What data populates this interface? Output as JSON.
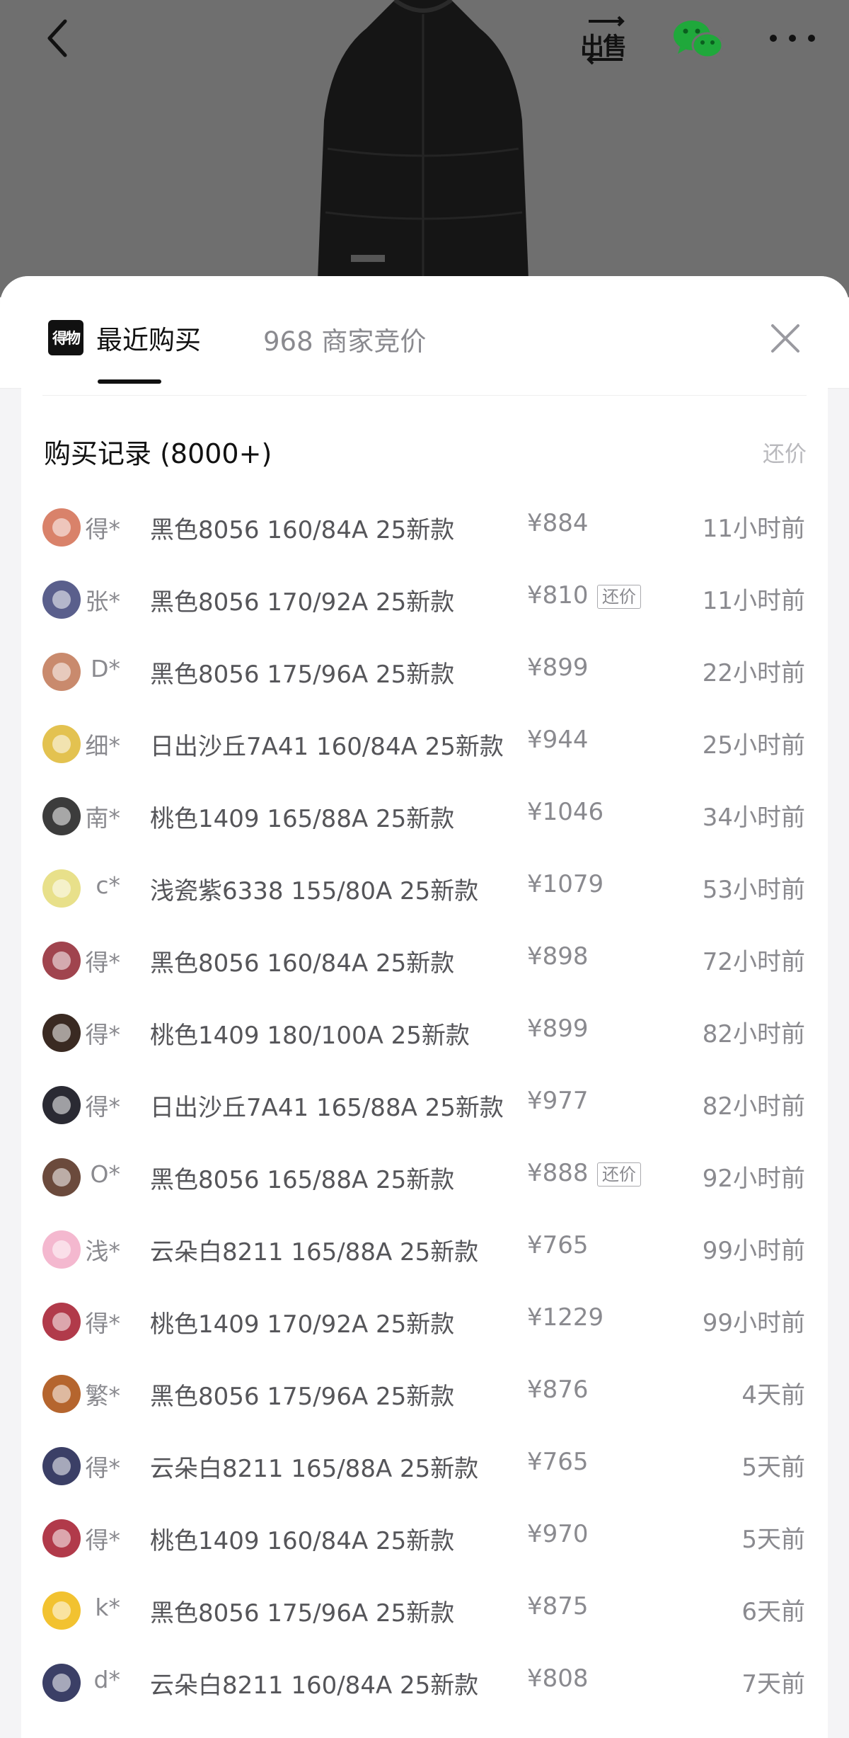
{
  "topbar": {
    "back_icon": "back-arrow-icon",
    "sell_label": "出售",
    "wechat_icon": "wechat-icon",
    "more_icon": "more-dots-icon"
  },
  "tabs": {
    "logo_text": "得物",
    "recent_label": "最近购买",
    "merchant_label": "968 商家竞价"
  },
  "records": {
    "title": "购买记录 (8000+)",
    "bargain_link": "还价",
    "badge_label": "还价",
    "rows": [
      {
        "user": "得*",
        "spec": "黑色8056 160/84A 25新款",
        "price": "¥884",
        "time": "11小时前",
        "bargain": false,
        "avatar_color": "#d9826a"
      },
      {
        "user": "张*",
        "spec": "黑色8056 170/92A 25新款",
        "price": "¥810",
        "time": "11小时前",
        "bargain": true,
        "avatar_color": "#5a5f8c"
      },
      {
        "user": "D*",
        "spec": "黑色8056 175/96A 25新款",
        "price": "¥899",
        "time": "22小时前",
        "bargain": false,
        "avatar_color": "#c98a6d"
      },
      {
        "user": "细*",
        "spec": "日出沙丘7A41 160/84A 25新款",
        "price": "¥944",
        "time": "25小时前",
        "bargain": false,
        "avatar_color": "#e3c250"
      },
      {
        "user": "南*",
        "spec": "桃色1409 165/88A 25新款",
        "price": "¥1046",
        "time": "34小时前",
        "bargain": false,
        "avatar_color": "#3c3c3c"
      },
      {
        "user": "c*",
        "spec": "浅瓷紫6338 155/80A 25新款",
        "price": "¥1079",
        "time": "53小时前",
        "bargain": false,
        "avatar_color": "#e8e08a"
      },
      {
        "user": "得*",
        "spec": "黑色8056 160/84A 25新款",
        "price": "¥898",
        "time": "72小时前",
        "bargain": false,
        "avatar_color": "#a0444e"
      },
      {
        "user": "得*",
        "spec": "桃色1409 180/100A 25新款",
        "price": "¥899",
        "time": "82小时前",
        "bargain": false,
        "avatar_color": "#3a2a22"
      },
      {
        "user": "得*",
        "spec": "日出沙丘7A41 165/88A 25新款",
        "price": "¥977",
        "time": "82小时前",
        "bargain": false,
        "avatar_color": "#2a2a33"
      },
      {
        "user": "O*",
        "spec": "黑色8056 165/88A 25新款",
        "price": "¥888",
        "time": "92小时前",
        "bargain": true,
        "avatar_color": "#6b4a3c"
      },
      {
        "user": "浅*",
        "spec": "云朵白8211 165/88A 25新款",
        "price": "¥765",
        "time": "99小时前",
        "bargain": false,
        "avatar_color": "#f4b8cf"
      },
      {
        "user": "得*",
        "spec": "桃色1409 170/92A 25新款",
        "price": "¥1229",
        "time": "99小时前",
        "bargain": false,
        "avatar_color": "#b13a4a"
      },
      {
        "user": "繁*",
        "spec": "黑色8056 175/96A 25新款",
        "price": "¥876",
        "time": "4天前",
        "bargain": false,
        "avatar_color": "#b5652e"
      },
      {
        "user": "得*",
        "spec": "云朵白8211 165/88A 25新款",
        "price": "¥765",
        "time": "5天前",
        "bargain": false,
        "avatar_color": "#3b3f66"
      },
      {
        "user": "得*",
        "spec": "桃色1409 160/84A 25新款",
        "price": "¥970",
        "time": "5天前",
        "bargain": false,
        "avatar_color": "#b13a4a"
      },
      {
        "user": "k*",
        "spec": "黑色8056 175/96A 25新款",
        "price": "¥875",
        "time": "6天前",
        "bargain": false,
        "avatar_color": "#f2c230"
      },
      {
        "user": "d*",
        "spec": "云朵白8211 160/84A 25新款",
        "price": "¥808",
        "time": "7天前",
        "bargain": false,
        "avatar_color": "#3b3f66"
      }
    ]
  }
}
